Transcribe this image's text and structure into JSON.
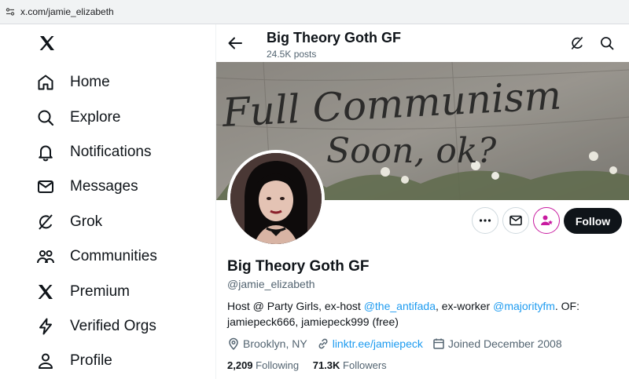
{
  "browser": {
    "url": "x.com/jamie_elizabeth"
  },
  "nav": {
    "items": [
      {
        "label": "Home",
        "icon": "home-icon"
      },
      {
        "label": "Explore",
        "icon": "search-icon"
      },
      {
        "label": "Notifications",
        "icon": "bell-icon"
      },
      {
        "label": "Messages",
        "icon": "mail-icon"
      },
      {
        "label": "Grok",
        "icon": "grok-icon"
      },
      {
        "label": "Communities",
        "icon": "communities-icon"
      },
      {
        "label": "Premium",
        "icon": "x-logo-icon"
      },
      {
        "label": "Verified Orgs",
        "icon": "lightning-icon"
      },
      {
        "label": "Profile",
        "icon": "person-icon"
      }
    ]
  },
  "header": {
    "title": "Big Theory Goth GF",
    "post_count": "24.5K posts"
  },
  "banner": {
    "graffiti_line1": "Full Communism",
    "graffiti_line2": "Soon, ok?"
  },
  "profile": {
    "name": "Big Theory Goth GF",
    "handle": "@jamie_elizabeth",
    "bio": {
      "part1": "Host @ Party Girls, ex-host ",
      "link1": "@the_antifada",
      "part2": ", ex-worker ",
      "link2": "@majorityfm",
      "part3": ". OF: jamiepeck666, jamiepeck999 (free)"
    },
    "location": "Brooklyn, NY",
    "website": "linktr.ee/jamiepeck",
    "joined": "Joined December 2008",
    "following_count": "2,209",
    "following_label": "Following",
    "followers_count": "71.3K",
    "followers_label": "Followers",
    "follow_label": "Follow"
  },
  "colors": {
    "accent": "#1d9bf0",
    "text": "#0f1419",
    "muted": "#536471",
    "subscribe": "#c81aa0"
  }
}
